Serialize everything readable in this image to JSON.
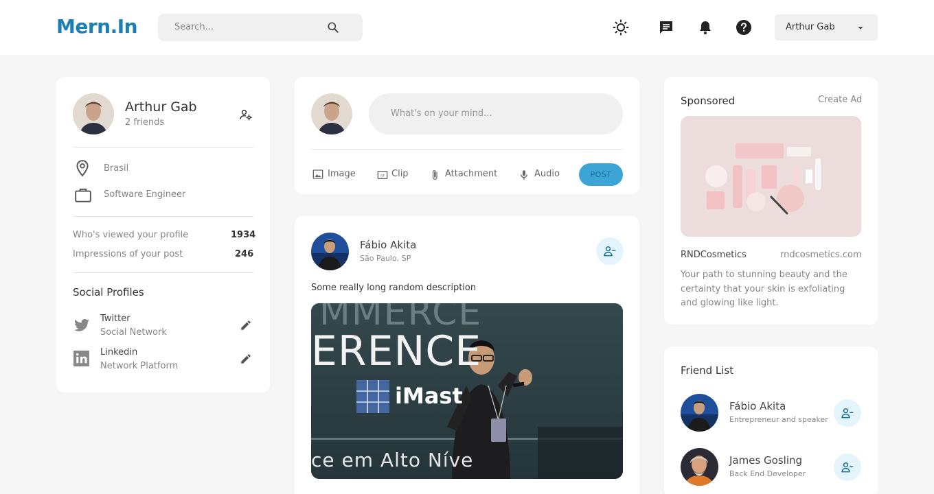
{
  "navbar": {
    "logo": "Mern.In",
    "search_placeholder": "Search...",
    "user_name": "Arthur Gab",
    "icons": [
      "search-icon",
      "light-mode-icon",
      "message-icon",
      "notification-icon",
      "help-icon",
      "caret-down-icon"
    ]
  },
  "profile": {
    "name": "Arthur Gab",
    "friends": "2 friends",
    "location": "Brasil",
    "occupation": "Software Engineer",
    "stats": [
      {
        "label": "Who's viewed your profile",
        "value": "1934"
      },
      {
        "label": "Impressions of your post",
        "value": "246"
      }
    ],
    "social_title": "Social Profiles",
    "socials": [
      {
        "name": "Twitter",
        "type": "Social Network"
      },
      {
        "name": "Linkedin",
        "type": "Network Platform"
      }
    ]
  },
  "composer": {
    "placeholder": "What's on your mind...",
    "actions": [
      "Image",
      "Clip",
      "Attachment",
      "Audio"
    ],
    "post_label": "POST"
  },
  "post": {
    "author": "Fábio Akita",
    "location": "São Paulo, SP",
    "description": "Some really long random description",
    "image_text_top": "ERENCE",
    "image_text_cut": "MMERCE",
    "image_brand": "iMast",
    "image_text_bottom": "ce em Alto Níve"
  },
  "sponsored": {
    "title": "Sponsored",
    "create_ad": "Create Ad",
    "brand": "RNDCosmetics",
    "url": "rndcosmetics.com",
    "description": "Your path to stunning beauty and the certainty that your skin is exfoliating and glowing like light."
  },
  "friend_list": {
    "title": "Friend List",
    "friends": [
      {
        "name": "Fábio Akita",
        "role": "Entrepreneur and speaker"
      },
      {
        "name": "James Gosling",
        "role": "Back End Developer"
      }
    ]
  },
  "colors": {
    "brand": "#1a7fb5",
    "accent": "#3da4d6",
    "accent_light": "#e3f4fc",
    "background": "#f6f6f6"
  }
}
